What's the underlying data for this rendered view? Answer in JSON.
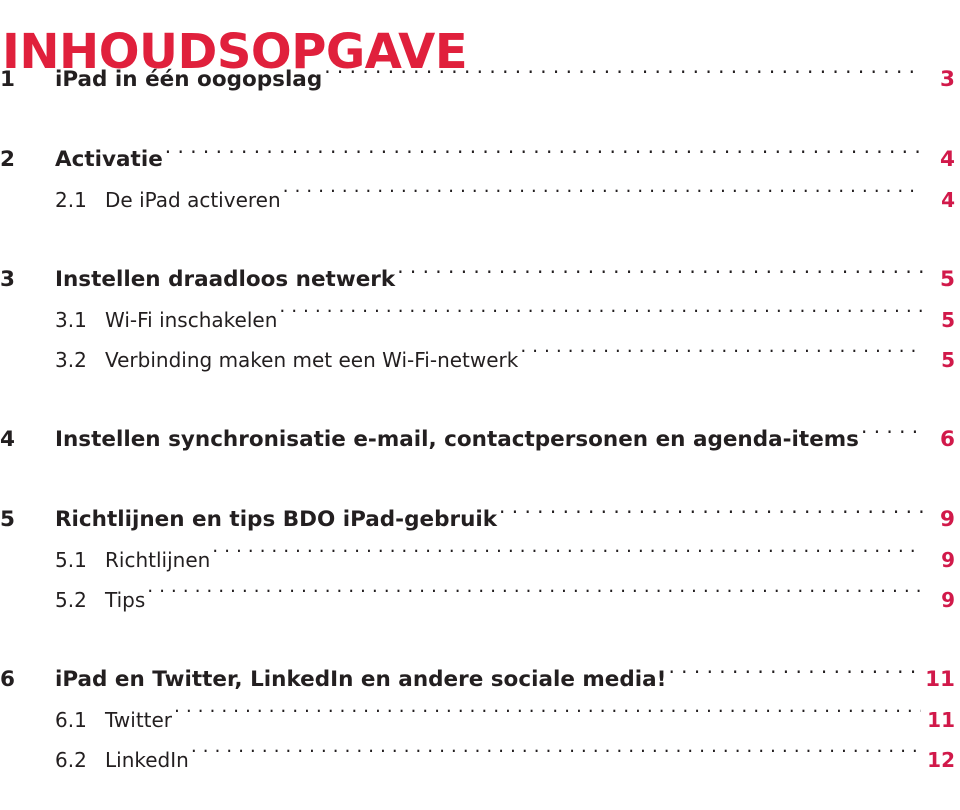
{
  "document": {
    "title": "INHOUDSOPGAVE",
    "title_color": "#e0203c",
    "pagenum_color": "#d1194a",
    "text_color": "#231f20",
    "background_color": "#ffffff",
    "leader_style": "dotted"
  },
  "entries": [
    {
      "level": 1,
      "number": "1",
      "label": "iPad in één oogopslag",
      "page": "3",
      "spacer_after": true
    },
    {
      "level": 1,
      "number": "2",
      "label": "Activatie",
      "page": "4",
      "spacer_after": false
    },
    {
      "level": 2,
      "number": "2.1",
      "label": "De iPad activeren",
      "page": "4",
      "spacer_after": true
    },
    {
      "level": 1,
      "number": "3",
      "label": "Instellen draadloos netwerk",
      "page": "5",
      "spacer_after": false
    },
    {
      "level": 2,
      "number": "3.1",
      "label": "Wi-Fi inschakelen",
      "page": "5",
      "spacer_after": false
    },
    {
      "level": 2,
      "number": "3.2",
      "label": "Verbinding maken met een Wi-Fi-netwerk",
      "page": "5",
      "spacer_after": true
    },
    {
      "level": 1,
      "number": "4",
      "label": "Instellen synchronisatie e-mail, contactpersonen en agenda-items",
      "page": "6",
      "spacer_after": true
    },
    {
      "level": 1,
      "number": "5",
      "label": "Richtlijnen en tips BDO iPad-gebruik",
      "page": "9",
      "spacer_after": false
    },
    {
      "level": 2,
      "number": "5.1",
      "label": "Richtlijnen",
      "page": "9",
      "spacer_after": false
    },
    {
      "level": 2,
      "number": "5.2",
      "label": "Tips",
      "page": "9",
      "spacer_after": true
    },
    {
      "level": 1,
      "number": "6",
      "label": "iPad en Twitter, LinkedIn en andere sociale media!",
      "page": "11",
      "spacer_after": false
    },
    {
      "level": 2,
      "number": "6.1",
      "label": "Twitter",
      "page": "11",
      "spacer_after": false
    },
    {
      "level": 2,
      "number": "6.2",
      "label": "LinkedIn",
      "page": "12",
      "spacer_after": false
    }
  ]
}
